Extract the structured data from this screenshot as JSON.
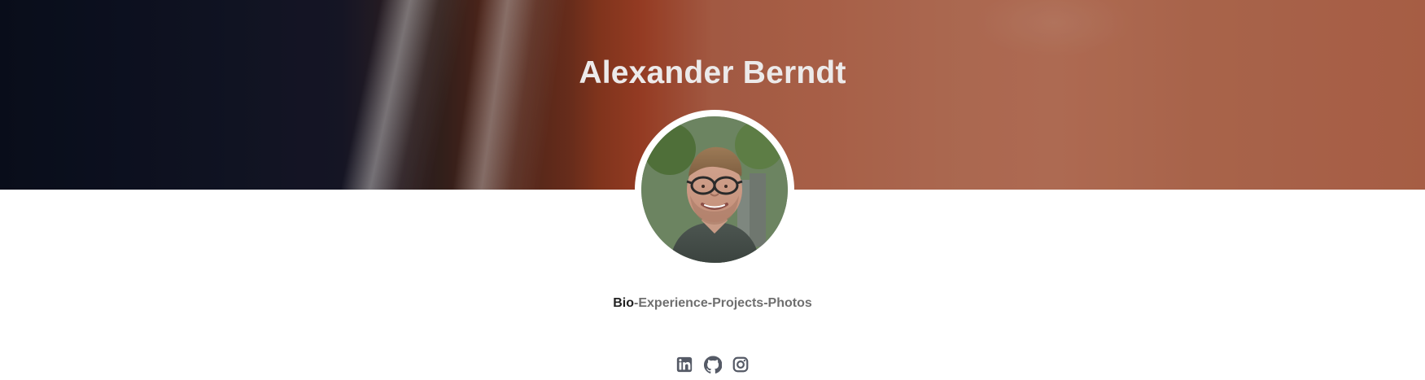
{
  "profile": {
    "name": "Alexander Berndt"
  },
  "nav": {
    "items": [
      {
        "label": "Bio",
        "active": true
      },
      {
        "label": "Experience",
        "active": false
      },
      {
        "label": "Projects",
        "active": false
      },
      {
        "label": "Photos",
        "active": false
      }
    ],
    "separator": " - "
  },
  "socials": {
    "items": [
      {
        "icon": "linkedin-icon"
      },
      {
        "icon": "github-icon"
      },
      {
        "icon": "instagram-icon"
      }
    ]
  },
  "colors": {
    "hero_text": "#eceaea",
    "nav_active": "#222222",
    "nav_inactive": "#6f6f6f",
    "icon": "#555a66"
  }
}
